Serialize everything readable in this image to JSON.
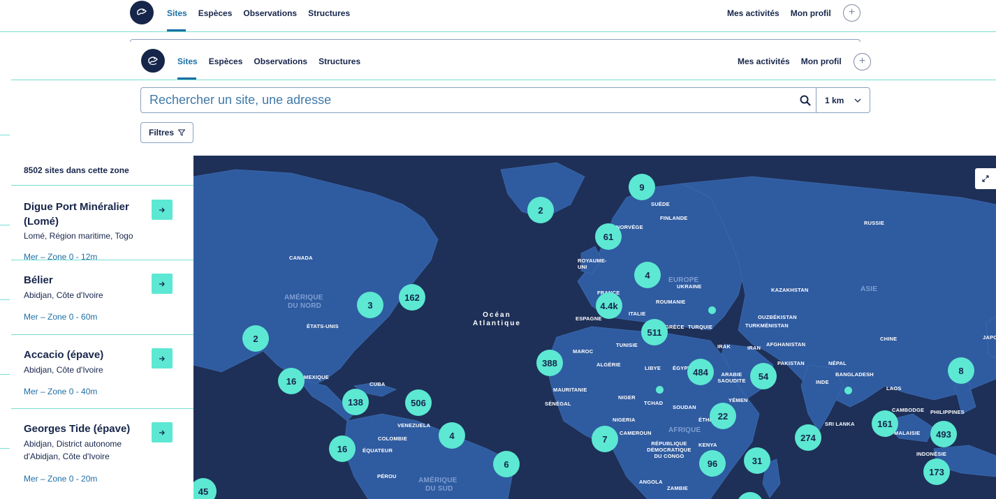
{
  "nav": {
    "tabs": [
      {
        "label": "Sites"
      },
      {
        "label": "Espèces"
      },
      {
        "label": "Observations"
      },
      {
        "label": "Structures"
      }
    ],
    "right": [
      "Mes activités",
      "Mon profil"
    ],
    "plus": "+"
  },
  "ghost_search_fragment": "Rechercher un site, une adresse",
  "search": {
    "placeholder": "Rechercher un site, une adresse",
    "radius": "1 km"
  },
  "filters_label": "Filtres",
  "sidebar": {
    "count": "8502 sites dans cette zone",
    "sites": [
      {
        "title": "Digue Port Minéralier (Lomé)",
        "address": "Lomé, Région maritime, Togo",
        "zone": "Mer – Zone 0 - 12m"
      },
      {
        "title": "Bélier",
        "address": "Abidjan, Côte d'Ivoire",
        "zone": "Mer – Zone 0 - 60m"
      },
      {
        "title": "Accacio (épave)",
        "address": "Abidjan, Côte d'Ivoire",
        "zone": "Mer – Zone 0 - 40m"
      },
      {
        "title": "Georges Tide (épave)",
        "address": "Abidjan, District autonome d'Abidjan, Côte d'Ivoire",
        "zone": "Mer – Zone 0 - 20m"
      }
    ]
  },
  "map": {
    "colors": {
      "ocean": "#1e3057",
      "land": "#2f5ba0",
      "cluster": "#5ce8d2"
    },
    "ocean_label": [
      "Océan",
      "Atlantique"
    ],
    "region_labels": [
      "AMÉRIQUE",
      "DU NORD",
      "AMÉRIQUE",
      "DU SUD",
      "AFRIQUE",
      "EUROPE",
      "ASIE"
    ],
    "country_labels": [
      "CANADA",
      "ÉTATS-UNIS",
      "MEXIQUE",
      "CUBA",
      "VENEZUELA",
      "COLOMBIE",
      "ÉQUATEUR",
      "PÉROU",
      "ROYAUME-UNI",
      "NORVÈGE",
      "SUÈDE",
      "FINLANDE",
      "RUSSIE",
      "UKRAINE",
      "ROUMANIE",
      "FRANCE",
      "ESPAGNE",
      "ITALIE",
      "GRÈCE",
      "TURQUIE",
      "KAZAKHSTAN",
      "OUZBÉKISTAN",
      "TURKMÉNISTAN",
      "AFGHANISTAN",
      "PAKISTAN",
      "NÉPAL",
      "CHINE",
      "INDE",
      "BANGLADESH",
      "LAOS",
      "CAMBODGE",
      "PHILIPPINES",
      "MALAISIE",
      "INDONÉSIE",
      "SRI LANKA",
      "IRAK",
      "IRAN",
      "ARABIE SAOUDITE",
      "YÉMEN",
      "ÉGYPTE",
      "LIBYE",
      "TUNISIE",
      "ALGÉRIE",
      "MAROC",
      "MAURITANIE",
      "SÉNÉGAL",
      "NIGER",
      "TCHAD",
      "SOUDAN",
      "NIGERIA",
      "CAMEROUN",
      "ÉTHIOPIE",
      "KENYA",
      "RÉPUBLIQUE DÉMOCRATIQUE DU CONGO",
      "ANGOLA",
      "ZAMBIE",
      "JAPON"
    ],
    "clusters": [
      "9",
      "2",
      "61",
      "4",
      "4.4k",
      "511",
      "3",
      "162",
      "2",
      "388",
      "484",
      "54",
      "16",
      "138",
      "506",
      "4",
      "16",
      "6",
      "7",
      "22",
      "96",
      "31",
      "274",
      "161",
      "8",
      "493",
      "173",
      "45"
    ]
  }
}
